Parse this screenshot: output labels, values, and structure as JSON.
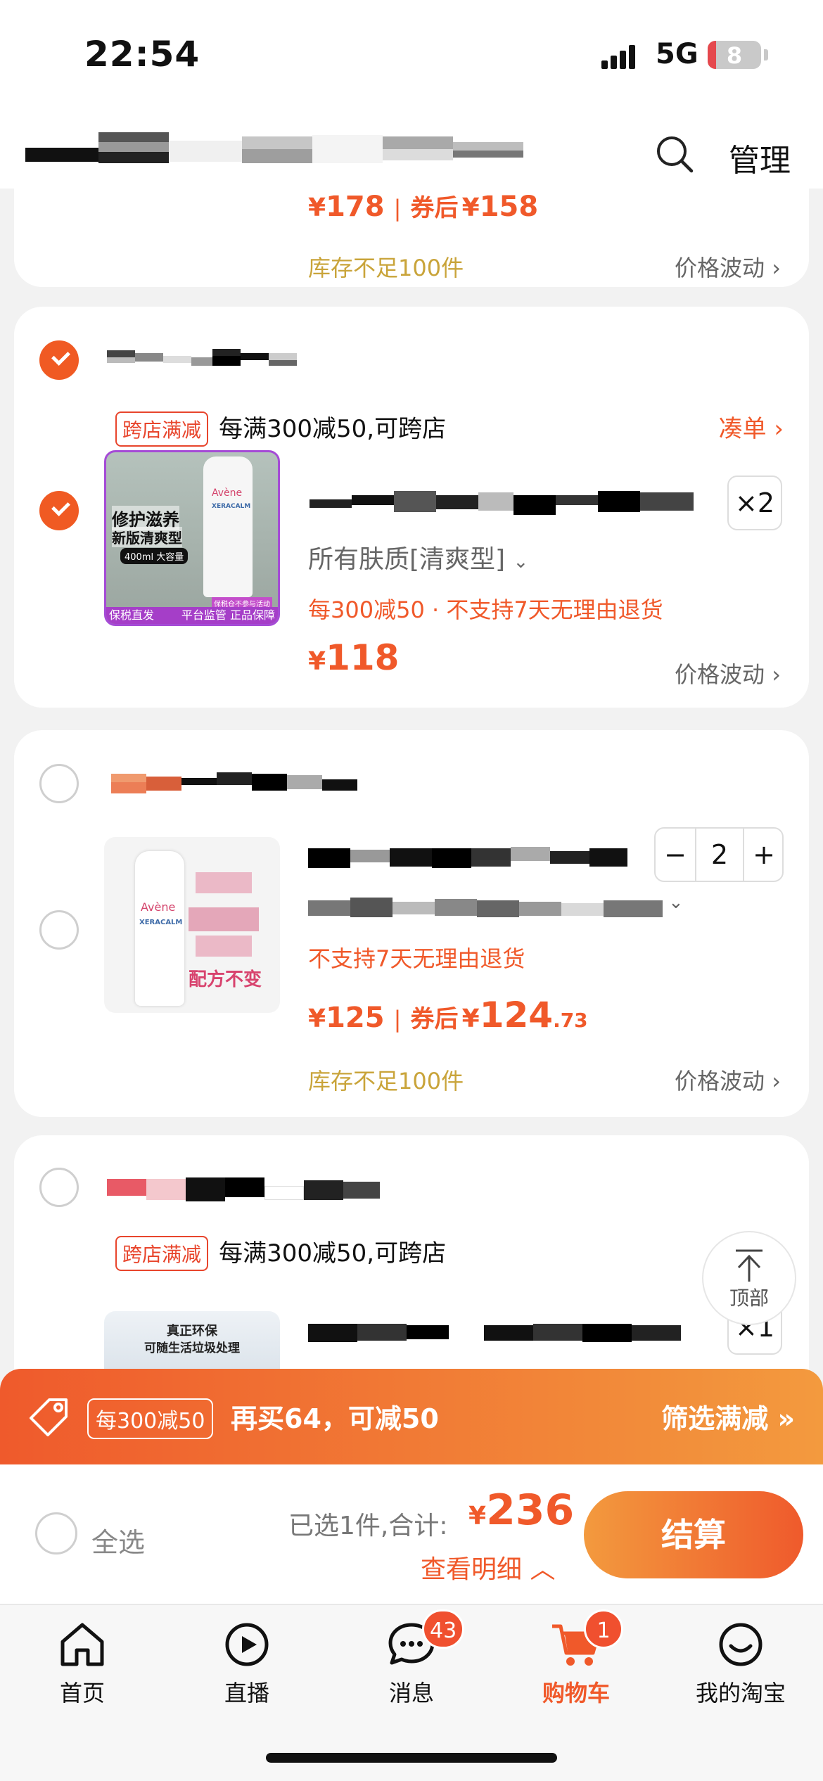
{
  "status_bar": {
    "time": "22:54",
    "network": "5G",
    "battery": "8"
  },
  "header": {
    "manage_label": "管理"
  },
  "cards": [
    {
      "price": "178",
      "after_coupon_label": "券后",
      "after_coupon_price": "158",
      "stock": "库存不足100件",
      "price_trend": "价格波动"
    },
    {
      "promo_tag": "跨店满减",
      "promo_text": "每满300减50,可跨店",
      "add_on_label": "凑单",
      "item": {
        "thumb_lines": [
          "修护滋养",
          "新版清爽型"
        ],
        "thumb_badge": "400ml 大容量",
        "thumb_brand": "Avène",
        "thumb_product": "XERACALM",
        "thumb_note": "保税仓不参与活动",
        "thumb_footer_left": "保税直发",
        "thumb_footer_right": "平台监管 正品保障",
        "variant": "所有肤质[清爽型]",
        "notice": "每300减50 · 不支持7天无理由退货",
        "quantity": "×2",
        "price": "118",
        "price_trend": "价格波动"
      }
    },
    {
      "item": {
        "thumb_brand": "Avène",
        "thumb_product": "XERACALM",
        "thumb_slogan": "配方不变",
        "notice": "不支持7天无理由退货",
        "quantity": "2",
        "minus": "−",
        "plus": "+",
        "price": "125",
        "after_coupon_label": "券后",
        "after_coupon_int": "124",
        "after_coupon_dec": ".73",
        "stock": "库存不足100件",
        "price_trend": "价格波动"
      }
    },
    {
      "promo_tag": "跨店满减",
      "promo_text": "每满300减50,可跨店",
      "item": {
        "thumb_lines": [
          "真正环保",
          "可随生活垃圾处理"
        ],
        "quantity": "×1"
      }
    }
  ],
  "to_top_label": "顶部",
  "promo_bar": {
    "tag": "每300减50",
    "message": "再买64，可减50",
    "filter_label": "筛选满减"
  },
  "checkout": {
    "select_all": "全选",
    "summary": "已选1件,合计:",
    "currency": "¥",
    "total": "236",
    "detail": "查看明细",
    "pay": "结算"
  },
  "tabs": [
    {
      "label": "首页",
      "icon": "home-icon"
    },
    {
      "label": "直播",
      "icon": "live-icon"
    },
    {
      "label": "消息",
      "icon": "message-icon",
      "badge": "43"
    },
    {
      "label": "购物车",
      "icon": "cart-icon",
      "badge": "1",
      "active": true
    },
    {
      "label": "我的淘宝",
      "icon": "profile-icon"
    }
  ],
  "colors": {
    "accent": "#f0592a",
    "stock_gold": "#c9a43a",
    "promo_gradient_start": "#ef5a2c",
    "promo_gradient_end": "#f39a3e"
  }
}
